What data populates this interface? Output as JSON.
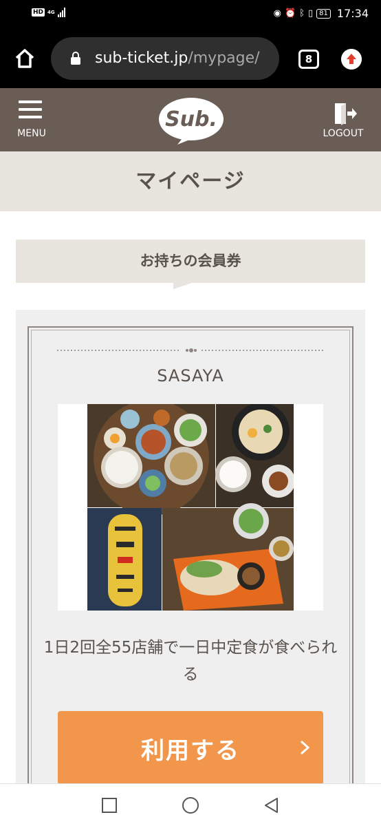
{
  "status_bar": {
    "network_badge": "HD",
    "network_type": "4G",
    "battery": "81",
    "time": "17:34"
  },
  "browser": {
    "url_domain": "sub-ticket.jp",
    "url_path": "/mypage/",
    "tab_count": "8"
  },
  "header": {
    "menu_label": "MENU",
    "logo_text": "Sub.",
    "logout_label": "LOGOUT",
    "color": "#695d55"
  },
  "page": {
    "title": "マイページ"
  },
  "section": {
    "heading": "お持ちの会員券"
  },
  "ticket": {
    "name": "SASAYA",
    "description": "1日2回全55店舗で一日中定食が食べられる",
    "use_button_label": "利用する",
    "button_color": "#f2964b"
  }
}
